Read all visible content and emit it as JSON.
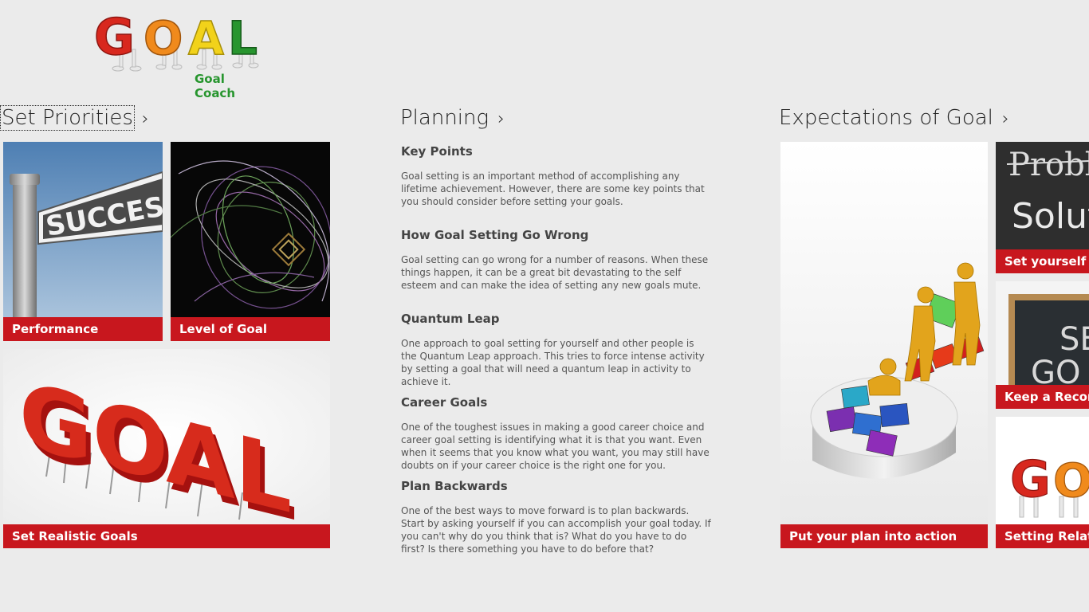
{
  "app": {
    "logo_text": "GOAL",
    "logo_subtitle": "Goal Coach"
  },
  "sections": {
    "set_priorities": {
      "title": "Set Priorities",
      "chevron": "chevron-right-icon"
    },
    "planning": {
      "title": "Planning",
      "chevron": "chevron-right-icon"
    },
    "expectations": {
      "title": "Expectations of Goal",
      "chevron": "chevron-right-icon"
    }
  },
  "tiles": {
    "performance": {
      "caption": "Performance",
      "sign_text": "SUCCESS"
    },
    "level_of_goal": {
      "caption": "Level of Goal"
    },
    "set_realistic_goals": {
      "caption": "Set Realistic Goals",
      "image_text": "GOAL"
    },
    "put_plan_into_action": {
      "caption": "Put your plan into action"
    },
    "set_yourself_up": {
      "caption": "Set yourself up",
      "board_top": "Problem",
      "board_bottom": "Solut"
    },
    "keep_a_record": {
      "caption": "Keep a Record",
      "board_top": "SE",
      "board_bottom": "GO"
    },
    "setting_relationships": {
      "caption": "Setting Relatio"
    }
  },
  "planning_items": [
    {
      "heading": "Key Points",
      "body": "Goal setting is an important method of accomplishing any lifetime achievement. However, there are some key points that you should consider before setting your goals."
    },
    {
      "heading": "How Goal Setting Go Wrong",
      "body": "Goal setting can go wrong for a number of reasons. When these things happen, it can be a great bit devastating to the self esteem and can make the idea of setting any new goals mute."
    },
    {
      "heading": "Quantum Leap",
      "body": "One approach to goal setting for yourself and other people is the Quantum Leap approach. This tries to force intense activity by setting a goal that will need a quantum leap in activity to achieve it."
    },
    {
      "heading": "Career Goals",
      "body": "One of the toughest issues in making a good career choice and career goal setting  is identifying what it is that you want. Even when it seems that you know what you want, you may still have doubts on if your career choice is the right one for you."
    },
    {
      "heading": "Plan Backwards",
      "body": "One of the best ways to move forward is to plan backwards. Start by asking yourself if you can accomplish your goal today. If you can't why do you think that is? What do you have to do first? Is there something you have to do before that?"
    }
  ],
  "colors": {
    "background": "#ebebeb",
    "caption_red": "#c8171e",
    "logo_g": "#d8281e",
    "logo_o": "#f08a1c",
    "logo_a": "#f2d21a",
    "logo_l": "#27952e"
  }
}
